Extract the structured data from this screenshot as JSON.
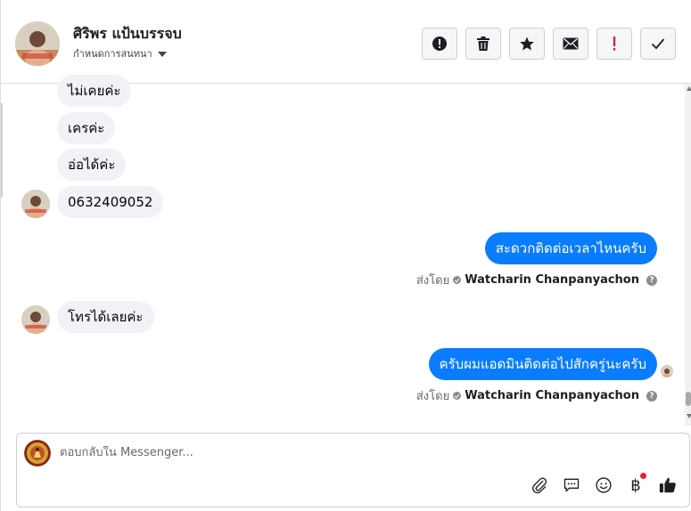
{
  "header": {
    "contact_name": "ศิริพร แป้นบรรจบ",
    "assign_label": "กำหนดการสนทนา",
    "actions": [
      {
        "name": "report-spam-button",
        "icon": "exclamation-circle-icon"
      },
      {
        "name": "delete-button",
        "icon": "trash-icon"
      },
      {
        "name": "star-button",
        "icon": "star-icon"
      },
      {
        "name": "mark-unread-button",
        "icon": "envelope-icon"
      },
      {
        "name": "mark-important-button",
        "icon": "exclamation-icon"
      },
      {
        "name": "mark-done-button",
        "icon": "checkmark-icon"
      }
    ]
  },
  "messages": {
    "in_1": "ไม่เคยค่ะ",
    "in_2": "เครค่ะ",
    "in_3": "อ่อได้ค่ะ",
    "in_4": "0632409052",
    "out_1": "สะดวกติดต่อเวลาไหนครับ",
    "in_5": "โทรได้เลยค่ะ",
    "out_2": "ครับผมแอดมินติดต่อไปสักครู่นะครับ"
  },
  "sent_by": {
    "prefix": "ส่งโดย",
    "sender": "Watcharin Chanpanyachon",
    "help_glyph": "?"
  },
  "composer": {
    "placeholder": "ตอบกลับใน Messenger...",
    "value": "",
    "tools": [
      "attachment-icon",
      "saved-replies-icon",
      "emoji-icon",
      "baht-payment-icon",
      "thumbs-up-icon"
    ],
    "baht_glyph": "฿"
  },
  "colors": {
    "outgoing_bubble": "#0a7cff",
    "incoming_bubble": "#f0f2f5",
    "badge": "#e41e3f"
  }
}
